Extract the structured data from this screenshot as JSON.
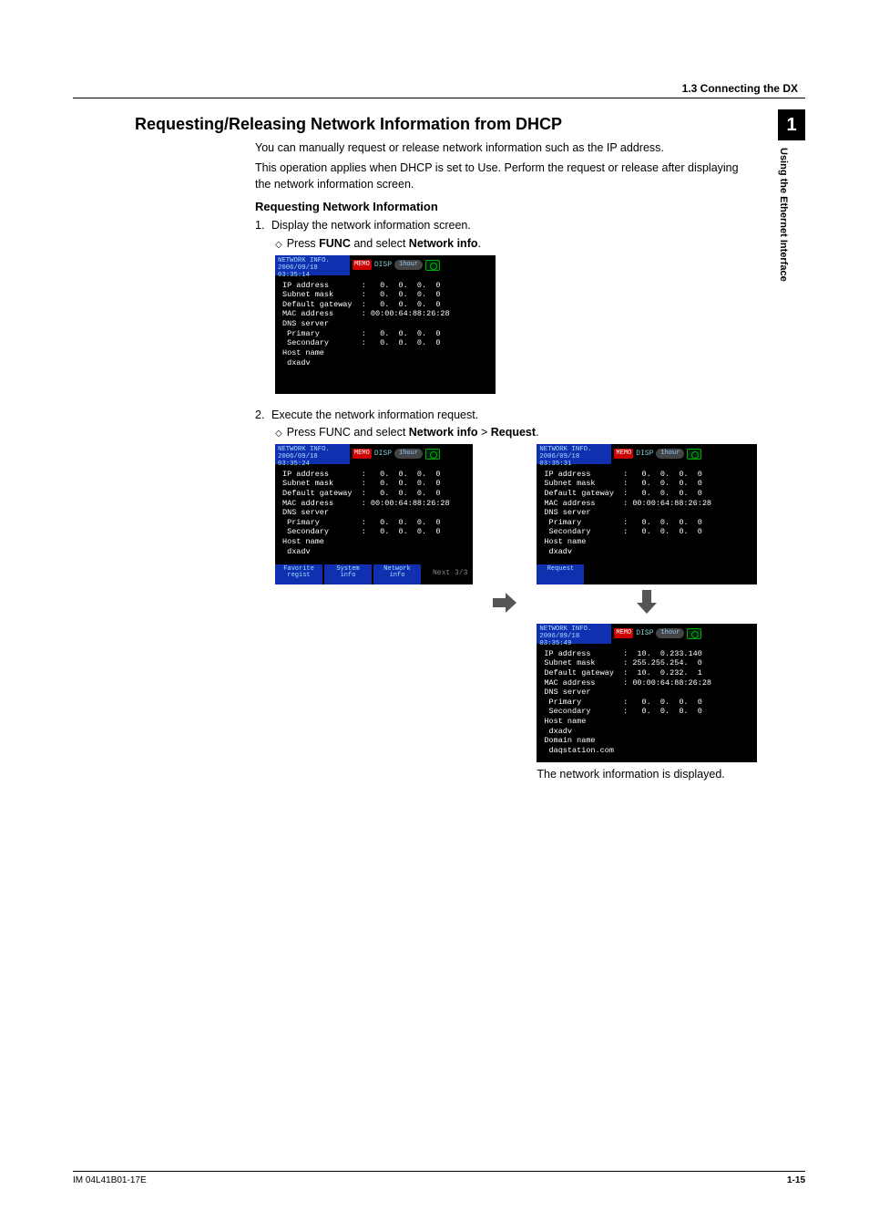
{
  "header": {
    "breadcrumb": "1.3  Connecting the DX"
  },
  "sidetab": {
    "chapter": "1",
    "label": "Using the Ethernet Interface"
  },
  "title": "Requesting/Releasing Network Information from DHCP",
  "intro1": "You can manually request or release network information such as the IP address.",
  "intro2": "This operation applies when DHCP is set to Use. Perform the request or release after displaying the network information screen.",
  "sub1": "Requesting Network Information",
  "step1": "Display the network information screen.",
  "step1sub_pre": "Press ",
  "step1sub_b1": "FUNC",
  "step1sub_mid": " and select ",
  "step1sub_b2": "Network info",
  "step1sub_end": ".",
  "step2": "Execute the network information request.",
  "step2sub_pre": "Press FUNC and select ",
  "step2sub_b1": "Network info",
  "step2sub_gt": " > ",
  "step2sub_b2": "Request",
  "step2sub_end": ".",
  "footer": {
    "left": "IM 04L41B01-17E",
    "right": "1-15"
  },
  "result_caption": "The network information is displayed.",
  "scr1": {
    "title": "NETWORK INFO.",
    "ts": "2006/09/18 03:35:14",
    "memo": "MEMO",
    "disp": "DISP",
    "time": "1hour",
    "lines": "IP address       :   0.  0.  0.  0\nSubnet mask      :   0.  0.  0.  0\nDefault gateway  :   0.  0.  0.  0\nMAC address      : 00:00:64:88:26:28\nDNS server\n Primary         :   0.  0.  0.  0\n Secondary       :   0.  0.  0.  0\nHost name\n dxadv"
  },
  "scr2": {
    "title": "NETWORK INFO.",
    "ts": "2006/09/18 03:35:24",
    "memo": "MEMO",
    "disp": "DISP",
    "time": "1hour",
    "lines": "IP address       :   0.  0.  0.  0\nSubnet mask      :   0.  0.  0.  0\nDefault gateway  :   0.  0.  0.  0\nMAC address      : 00:00:64:88:26:28\nDNS server\n Primary         :   0.  0.  0.  0\n Secondary       :   0.  0.  0.  0\nHost name\n dxadv",
    "sk1": "Favorite\nregist",
    "sk2": "System\ninfo",
    "sk3": "Network\ninfo",
    "next": "Next 3/3"
  },
  "scr3": {
    "title": "NETWORK INFO.",
    "ts": "2006/09/18 03:35:31",
    "memo": "MEMO",
    "disp": "DISP",
    "time": "1hour",
    "lines": "IP address       :   0.  0.  0.  0\nSubnet mask      :   0.  0.  0.  0\nDefault gateway  :   0.  0.  0.  0\nMAC address      : 00:00:64:88:26:28\nDNS server\n Primary         :   0.  0.  0.  0\n Secondary       :   0.  0.  0.  0\nHost name\n dxadv",
    "sk1": "Request"
  },
  "scr4": {
    "title": "NETWORK INFO.",
    "ts": "2006/09/18 03:35:49",
    "memo": "MEMO",
    "disp": "DISP",
    "time": "1hour",
    "lines": "IP address       :  10.  0.233.140\nSubnet mask      : 255.255.254.  0\nDefault gateway  :  10.  0.232.  1\nMAC address      : 00:00:64:88:26:28\nDNS server\n Primary         :   0.  0.  0.  0\n Secondary       :   0.  0.  0.  0\nHost name\n dxadv\nDomain name\n daqstation.com"
  }
}
